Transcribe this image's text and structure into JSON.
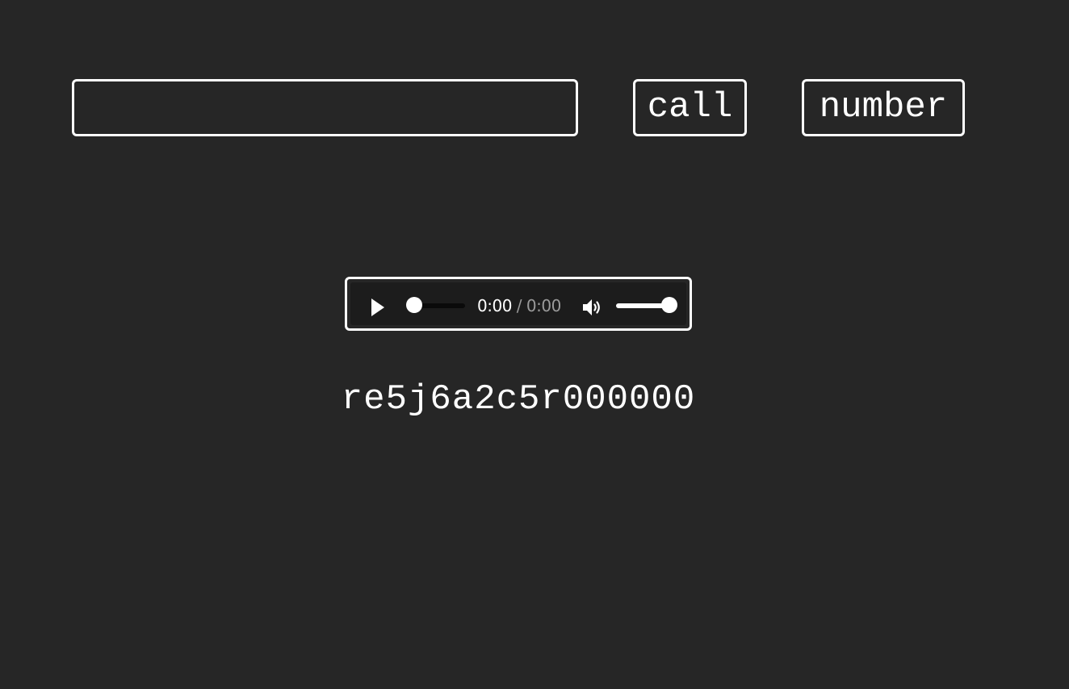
{
  "input": {
    "value": "",
    "placeholder": ""
  },
  "buttons": {
    "call_label": "call",
    "number_label": "number"
  },
  "audio_player": {
    "current_time": "0:00",
    "separator": "/",
    "total_time": "0:00",
    "progress": 0,
    "volume": 1.0,
    "icons": {
      "play": "play-icon",
      "volume": "volume-icon"
    }
  },
  "output_text": "re5j6a2c5r000000",
  "colors": {
    "background": "#262626",
    "foreground": "#ffffff",
    "player_background": "#1c1c1c",
    "muted_text": "#9a9a9a"
  }
}
